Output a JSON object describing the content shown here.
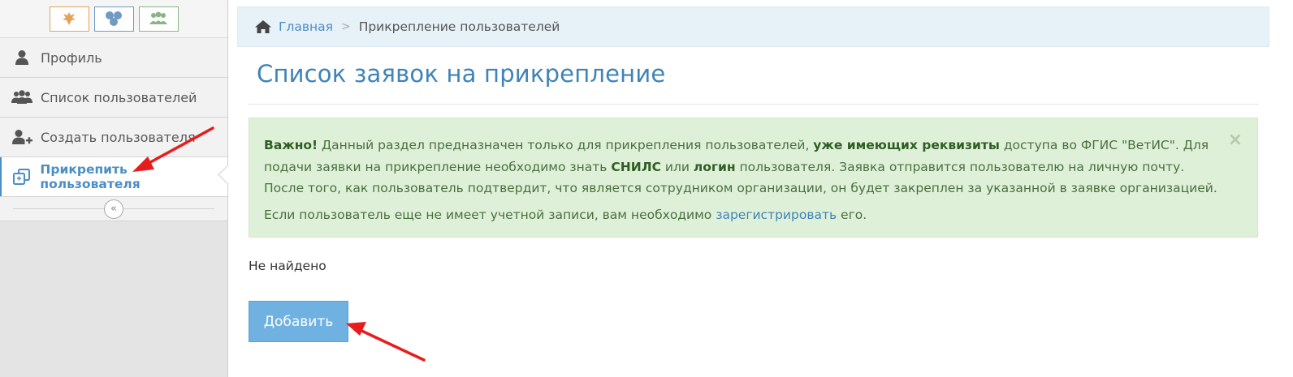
{
  "sidebar": {
    "items": [
      {
        "label": "Профиль",
        "icon": "user-icon"
      },
      {
        "label": "Список пользователей",
        "icon": "users-icon"
      },
      {
        "label": "Создать пользователя",
        "icon": "user-plus-icon"
      },
      {
        "label": "Прикрепить пользователя",
        "icon": "attach-icon",
        "active": true
      }
    ]
  },
  "breadcrumb": {
    "home": "Главная",
    "current": "Прикрепление пользователей"
  },
  "page": {
    "title": "Список заявок на прикрепление"
  },
  "alert": {
    "important": "Важно!",
    "text1": " Данный раздел предназначен только для прикрепления пользователей, ",
    "bold1": "уже имеющих реквизиты",
    "text2": " доступа во ФГИС \"ВетИС\". Для подачи заявки на прикрепление необходимо знать ",
    "bold2": "СНИЛС",
    "text3": " или ",
    "bold3": "логин",
    "text4": " пользователя. Заявка отправится пользователю на личную почту. После того, как пользователь подтвердит, что является сотрудником организации, он будет закреплен за указанной в заявке организацией.",
    "text5": "Если пользователь еще не имеет учетной записи, вам необходимо ",
    "link": "зарегистрировать",
    "text6": " его.",
    "close": "×"
  },
  "content": {
    "not_found": "Не найдено",
    "add_button": "Добавить"
  },
  "colors": {
    "accent": "#4b8ec5",
    "title": "#3f83b8",
    "alert_bg": "#dff0d8",
    "button_bg": "#6fb1e0",
    "arrow": "#e81c1c"
  }
}
